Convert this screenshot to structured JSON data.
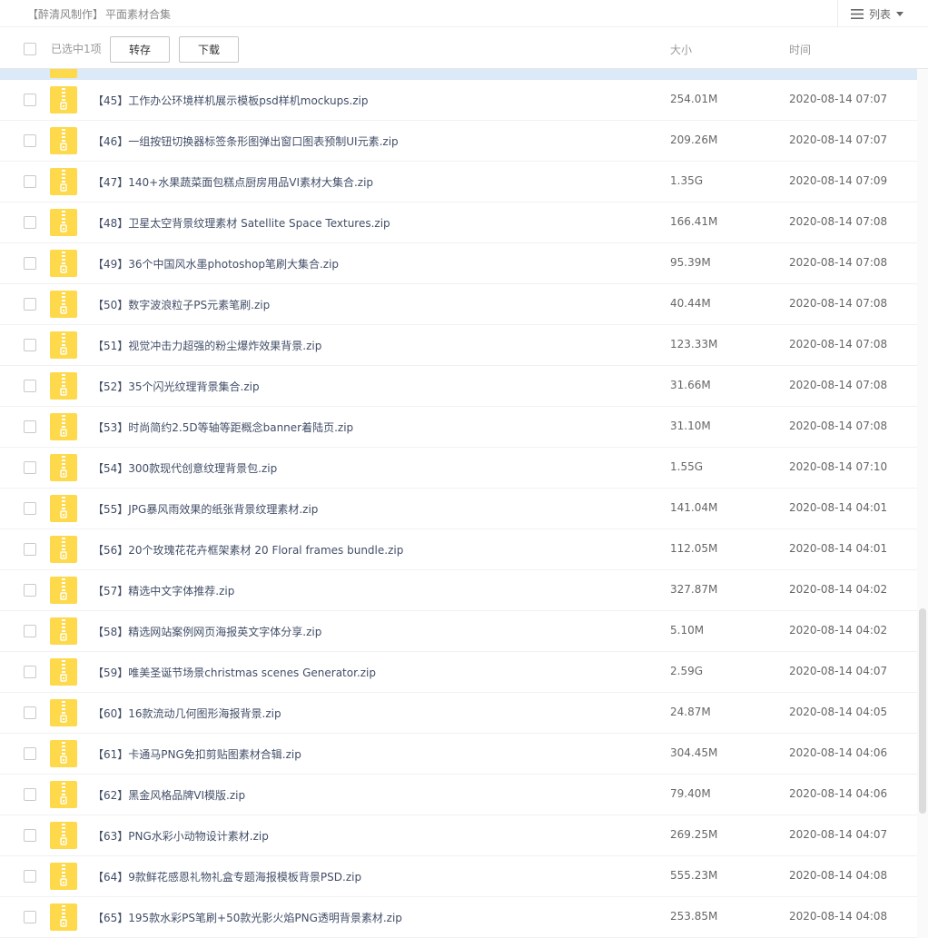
{
  "breadcrumb": {
    "parent": "【醉清风制作】",
    "current": "平面素材合集"
  },
  "view": {
    "label": "列表"
  },
  "toolbar": {
    "selected_text": "已选中1项",
    "save_label": "转存",
    "download_label": "下载"
  },
  "columns": {
    "size": "大小",
    "time": "时间"
  },
  "files": [
    {
      "name": "【45】工作办公环境样机展示模板psd样机mockups.zip",
      "size": "254.01M",
      "time": "2020-08-14 07:07"
    },
    {
      "name": "【46】一组按钮切换器标签条形图弹出窗口图表预制UI元素.zip",
      "size": "209.26M",
      "time": "2020-08-14 07:07"
    },
    {
      "name": "【47】140+水果蔬菜面包糕点厨房用品VI素材大集合.zip",
      "size": "1.35G",
      "time": "2020-08-14 07:09"
    },
    {
      "name": "【48】卫星太空背景纹理素材 Satellite Space Textures.zip",
      "size": "166.41M",
      "time": "2020-08-14 07:08"
    },
    {
      "name": "【49】36个中国风水墨photoshop笔刷大集合.zip",
      "size": "95.39M",
      "time": "2020-08-14 07:08"
    },
    {
      "name": "【50】数字波浪粒子PS元素笔刷.zip",
      "size": "40.44M",
      "time": "2020-08-14 07:08"
    },
    {
      "name": "【51】视觉冲击力超强的粉尘爆炸效果背景.zip",
      "size": "123.33M",
      "time": "2020-08-14 07:08"
    },
    {
      "name": "【52】35个闪光纹理背景集合.zip",
      "size": "31.66M",
      "time": "2020-08-14 07:08"
    },
    {
      "name": "【53】时尚简约2.5D等轴等距概念banner着陆页.zip",
      "size": "31.10M",
      "time": "2020-08-14 07:08"
    },
    {
      "name": "【54】300款现代创意纹理背景包.zip",
      "size": "1.55G",
      "time": "2020-08-14 07:10"
    },
    {
      "name": "【55】JPG暴风雨效果的纸张背景纹理素材.zip",
      "size": "141.04M",
      "time": "2020-08-14 04:01"
    },
    {
      "name": "【56】20个玫瑰花花卉框架素材 20 Floral frames bundle.zip",
      "size": "112.05M",
      "time": "2020-08-14 04:01"
    },
    {
      "name": "【57】精选中文字体推荐.zip",
      "size": "327.87M",
      "time": "2020-08-14 04:02"
    },
    {
      "name": "【58】精选网站案例网页海报英文字体分享.zip",
      "size": "5.10M",
      "time": "2020-08-14 04:02"
    },
    {
      "name": "【59】唯美圣诞节场景christmas scenes Generator.zip",
      "size": "2.59G",
      "time": "2020-08-14 04:07"
    },
    {
      "name": "【60】16款流动几何图形海报背景.zip",
      "size": "24.87M",
      "time": "2020-08-14 04:05"
    },
    {
      "name": "【61】卡通马PNG免扣剪贴图素材合辑.zip",
      "size": "304.45M",
      "time": "2020-08-14 04:06"
    },
    {
      "name": "【62】黑金风格品牌VI模版.zip",
      "size": "79.40M",
      "time": "2020-08-14 04:06"
    },
    {
      "name": "【63】PNG水彩小动物设计素材.zip",
      "size": "269.25M",
      "time": "2020-08-14 04:07"
    },
    {
      "name": "【64】9款鲜花感恩礼物礼盒专题海报模板背景PSD.zip",
      "size": "555.23M",
      "time": "2020-08-14 04:08"
    },
    {
      "name": "【65】195款水彩PS笔刷+50款光影火焰PNG透明背景素材.zip",
      "size": "253.85M",
      "time": "2020-08-14 04:08"
    }
  ],
  "colors": {
    "zip_icon": "#fdd94b",
    "selected_row": "#dbe9f9",
    "file_name": "#424e67"
  },
  "icons": {
    "file": "zip-file-icon",
    "view": "list-icon"
  }
}
